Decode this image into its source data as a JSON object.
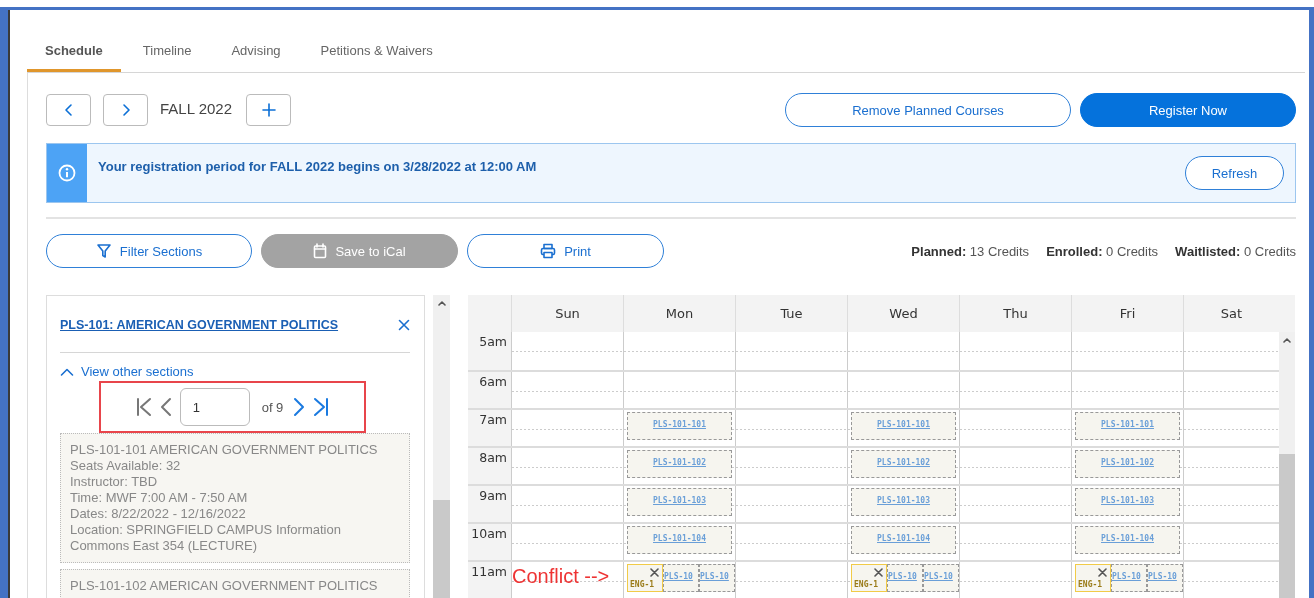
{
  "tabs": [
    {
      "label": "Schedule",
      "selected": true
    },
    {
      "label": "Timeline",
      "selected": false
    },
    {
      "label": "Advising",
      "selected": false
    },
    {
      "label": "Petitions & Waivers",
      "selected": false
    }
  ],
  "term": {
    "label": "FALL 2022"
  },
  "header_buttons": [
    {
      "label": "Remove Planned Courses",
      "kind": "outline"
    },
    {
      "label": "Register Now",
      "kind": "primary"
    }
  ],
  "banner": {
    "message": "Your registration period for FALL 2022 begins on 3/28/2022 at 12:00 AM",
    "button": "Refresh"
  },
  "actions": [
    {
      "label": "Filter Sections",
      "kind": "filter",
      "disabled": false
    },
    {
      "label": "Save to iCal",
      "kind": "calendar",
      "disabled": true
    },
    {
      "label": "Print",
      "kind": "print",
      "disabled": false
    }
  ],
  "credits": [
    {
      "label": "Planned:",
      "value": "13 Credits"
    },
    {
      "label": "Enrolled:",
      "value": "0 Credits"
    },
    {
      "label": "Waitlisted:",
      "value": "0 Credits"
    }
  ],
  "course": {
    "title": "PLS-101: AMERICAN GOVERNMENT POLITICS",
    "toggle": "View other sections",
    "expanded": true,
    "pager": {
      "value": "1",
      "total": "of 9"
    },
    "sections": [
      {
        "lines": [
          "PLS-101-101 AMERICAN GOVERNMENT POLITICS",
          "Seats Available: 32",
          "Instructor: TBD",
          "Time: MWF 7:00 AM - 7:50 AM",
          "Dates: 8/22/2022 - 12/16/2022",
          "Location: SPRINGFIELD CAMPUS Information Commons East 354 (LECTURE)"
        ]
      },
      {
        "lines": [
          "PLS-101-102 AMERICAN GOVERNMENT POLITICS"
        ]
      }
    ]
  },
  "calendar": {
    "days": [
      "Sun",
      "Mon",
      "Tue",
      "Wed",
      "Thu",
      "Fri",
      "Sat"
    ],
    "rows": [
      {
        "time": "5am",
        "cells": [
          [],
          [],
          [],
          [],
          [],
          [],
          []
        ]
      },
      {
        "time": "6am",
        "cells": [
          [],
          [],
          [],
          [],
          [],
          [],
          []
        ]
      },
      {
        "time": "7am",
        "cells": [
          [],
          [
            {
              "label": "PLS-101-101",
              "kind": "section"
            }
          ],
          [],
          [
            {
              "label": "PLS-101-101",
              "kind": "section"
            }
          ],
          [],
          [
            {
              "label": "PLS-101-101",
              "kind": "section"
            }
          ],
          []
        ]
      },
      {
        "time": "8am",
        "cells": [
          [],
          [
            {
              "label": "PLS-101-102",
              "kind": "section"
            }
          ],
          [],
          [
            {
              "label": "PLS-101-102",
              "kind": "section"
            }
          ],
          [],
          [
            {
              "label": "PLS-101-102",
              "kind": "section"
            }
          ],
          []
        ]
      },
      {
        "time": "9am",
        "cells": [
          [],
          [
            {
              "label": "PLS-101-103",
              "kind": "section"
            }
          ],
          [],
          [
            {
              "label": "PLS-101-103",
              "kind": "section"
            }
          ],
          [],
          [
            {
              "label": "PLS-101-103",
              "kind": "section"
            }
          ],
          []
        ]
      },
      {
        "time": "10am",
        "cells": [
          [],
          [
            {
              "label": "PLS-101-104",
              "kind": "section"
            }
          ],
          [],
          [
            {
              "label": "PLS-101-104",
              "kind": "section"
            }
          ],
          [],
          [
            {
              "label": "PLS-101-104",
              "kind": "section"
            }
          ],
          []
        ]
      },
      {
        "time": "11am",
        "note": "Conflict -->",
        "cells": [
          [],
          [
            {
              "label": "ENG-1",
              "kind": "conflict"
            },
            {
              "label": "PLS-10",
              "kind": "section"
            },
            {
              "label": "PLS-10",
              "kind": "section"
            }
          ],
          [],
          [
            {
              "label": "ENG-1",
              "kind": "conflict"
            },
            {
              "label": "PLS-10",
              "kind": "section"
            },
            {
              "label": "PLS-10",
              "kind": "section"
            }
          ],
          [],
          [
            {
              "label": "ENG-1",
              "kind": "conflict"
            },
            {
              "label": "PLS-10",
              "kind": "section"
            },
            {
              "label": "PLS-10",
              "kind": "section"
            }
          ],
          []
        ]
      }
    ]
  }
}
